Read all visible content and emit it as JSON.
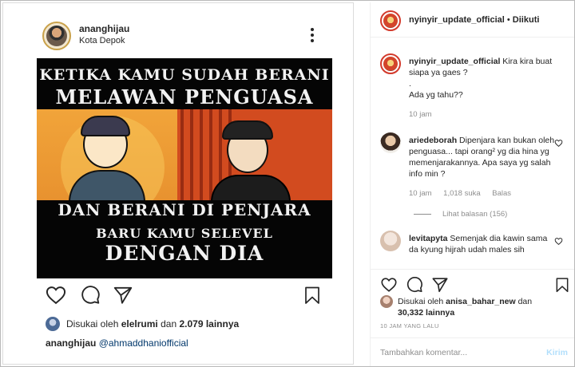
{
  "post": {
    "username": "ananghijau",
    "location": "Kota Depok",
    "image_text": {
      "line1": "KETIKA KAMU SUDAH BERANI",
      "line2": "MELAWAN PENGUASA",
      "line3": "DAN BERANI DI PENJARA",
      "line4": "BARU KAMU SELEVEL",
      "line5": "DENGAN DIA"
    },
    "likes": {
      "prefix": "Disukai oleh",
      "user": "elelrumi",
      "connector": "dan",
      "count": "2.079 lainnya"
    },
    "caption": {
      "user": "ananghijau",
      "mention": "@ahmaddhaniofficial"
    }
  },
  "side": {
    "header": {
      "username": "nyinyir_update_official",
      "separator": "•",
      "follow_label": "Diikuti"
    },
    "comments": [
      {
        "user": "nyinyir_update_official",
        "text_lines": [
          "Kira kira buat siapa ya gaes ?",
          ".",
          "Ada yg tahu??"
        ],
        "time": "10 jam"
      },
      {
        "user": "ariedeborah",
        "text": "Dipenjara kan bukan oleh penguasa... tapi orang² yg dia hina yg memenjarakannya. Apa saya yg salah info min ?",
        "time": "10 jam",
        "likes": "1,018 suka",
        "reply": "Balas",
        "view_replies": "Lihat balasan (156)"
      },
      {
        "user": "levitapyta",
        "text": "Semenjak dia kawin sama da kyung hijrah udah males sih"
      }
    ],
    "likes": {
      "prefix": "Disukai oleh",
      "user": "anisa_bahar_new",
      "connector": "dan",
      "count": "30,332 lainnya"
    },
    "timestamp": "10 JAM YANG LALU",
    "comment_input": {
      "placeholder": "Tambahkan komentar...",
      "send_label": "Kirim"
    }
  }
}
